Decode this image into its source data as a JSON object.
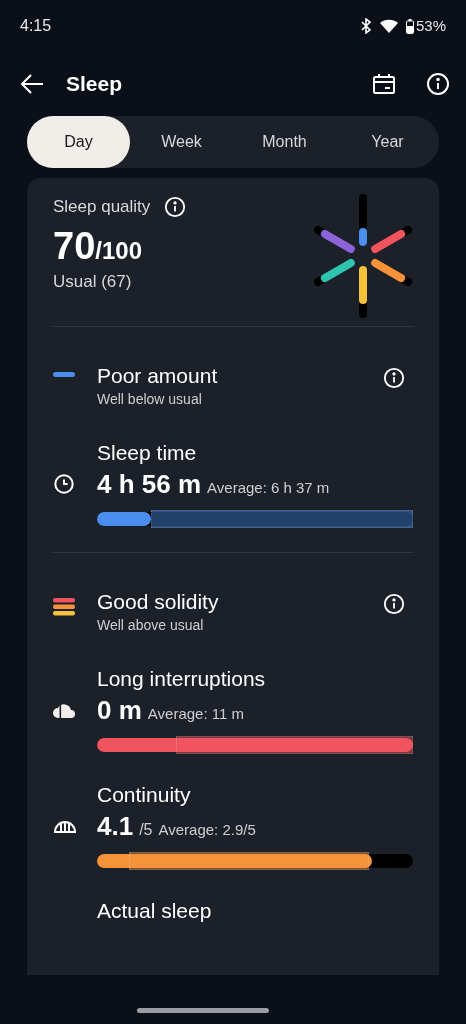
{
  "status_bar": {
    "time": "4:15",
    "battery": "53%"
  },
  "header": {
    "title": "Sleep"
  },
  "tabs": [
    {
      "label": "Day",
      "selected": true
    },
    {
      "label": "Week",
      "selected": false
    },
    {
      "label": "Month",
      "selected": false
    },
    {
      "label": "Year",
      "selected": false
    }
  ],
  "quality": {
    "label": "Sleep quality",
    "score": "70",
    "max": "/100",
    "usual": "Usual (67)"
  },
  "sections": [
    {
      "kind": "amount",
      "title": "Poor amount",
      "subtitle": "Well below usual",
      "metrics": [
        {
          "label": "Sleep time",
          "value": "4 h 56 m",
          "average": "Average: 6 h 37 m",
          "color": "#4a8ef0",
          "level": 0.17
        }
      ]
    },
    {
      "kind": "solidity",
      "title": "Good solidity",
      "subtitle": "Well above usual",
      "metrics": [
        {
          "label": "Long interruptions",
          "value": "0 m",
          "average": "Average: 11 m",
          "color": "#f0545e",
          "level": 1
        },
        {
          "label": "Continuity",
          "value": "4.1",
          "unit": "/5",
          "average": "Average: 2.9/5",
          "color": "#f5923a",
          "level": 0.87
        },
        {
          "label": "Actual sleep"
        }
      ]
    }
  ]
}
